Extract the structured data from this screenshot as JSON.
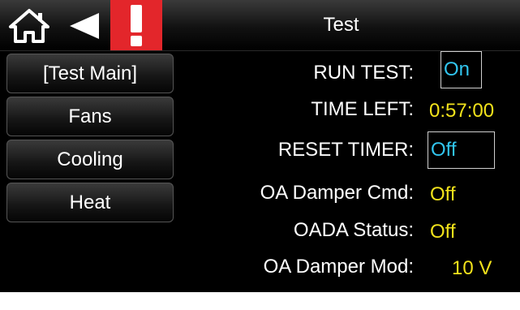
{
  "header": {
    "title": "Test",
    "icons": {
      "home": "home-icon",
      "back": "back-arrow-icon",
      "alarm": "alarm-exclamation-icon"
    },
    "alarm_color": "#e3262b"
  },
  "sidebar": {
    "items": [
      {
        "label": "[Test Main]"
      },
      {
        "label": "Fans"
      },
      {
        "label": "Cooling"
      },
      {
        "label": "Heat"
      }
    ]
  },
  "rows": {
    "run_test": {
      "label": "RUN TEST:",
      "value": "On"
    },
    "time_left": {
      "label": "TIME LEFT:",
      "value": "0:57:00"
    },
    "reset_timer": {
      "label": "RESET TIMER:",
      "value": "Off"
    },
    "oa_damper_cmd": {
      "label": "OA Damper Cmd:",
      "value": "Off"
    },
    "oada_status": {
      "label": "OADA Status:",
      "value": "Off"
    },
    "oa_damper_mod": {
      "label": "OA Damper Mod:",
      "value": "10 V"
    }
  },
  "colors": {
    "background": "#000000",
    "editable_value": "#31c5ef",
    "readonly_value": "#f2e21b",
    "label": "#ffffff"
  }
}
